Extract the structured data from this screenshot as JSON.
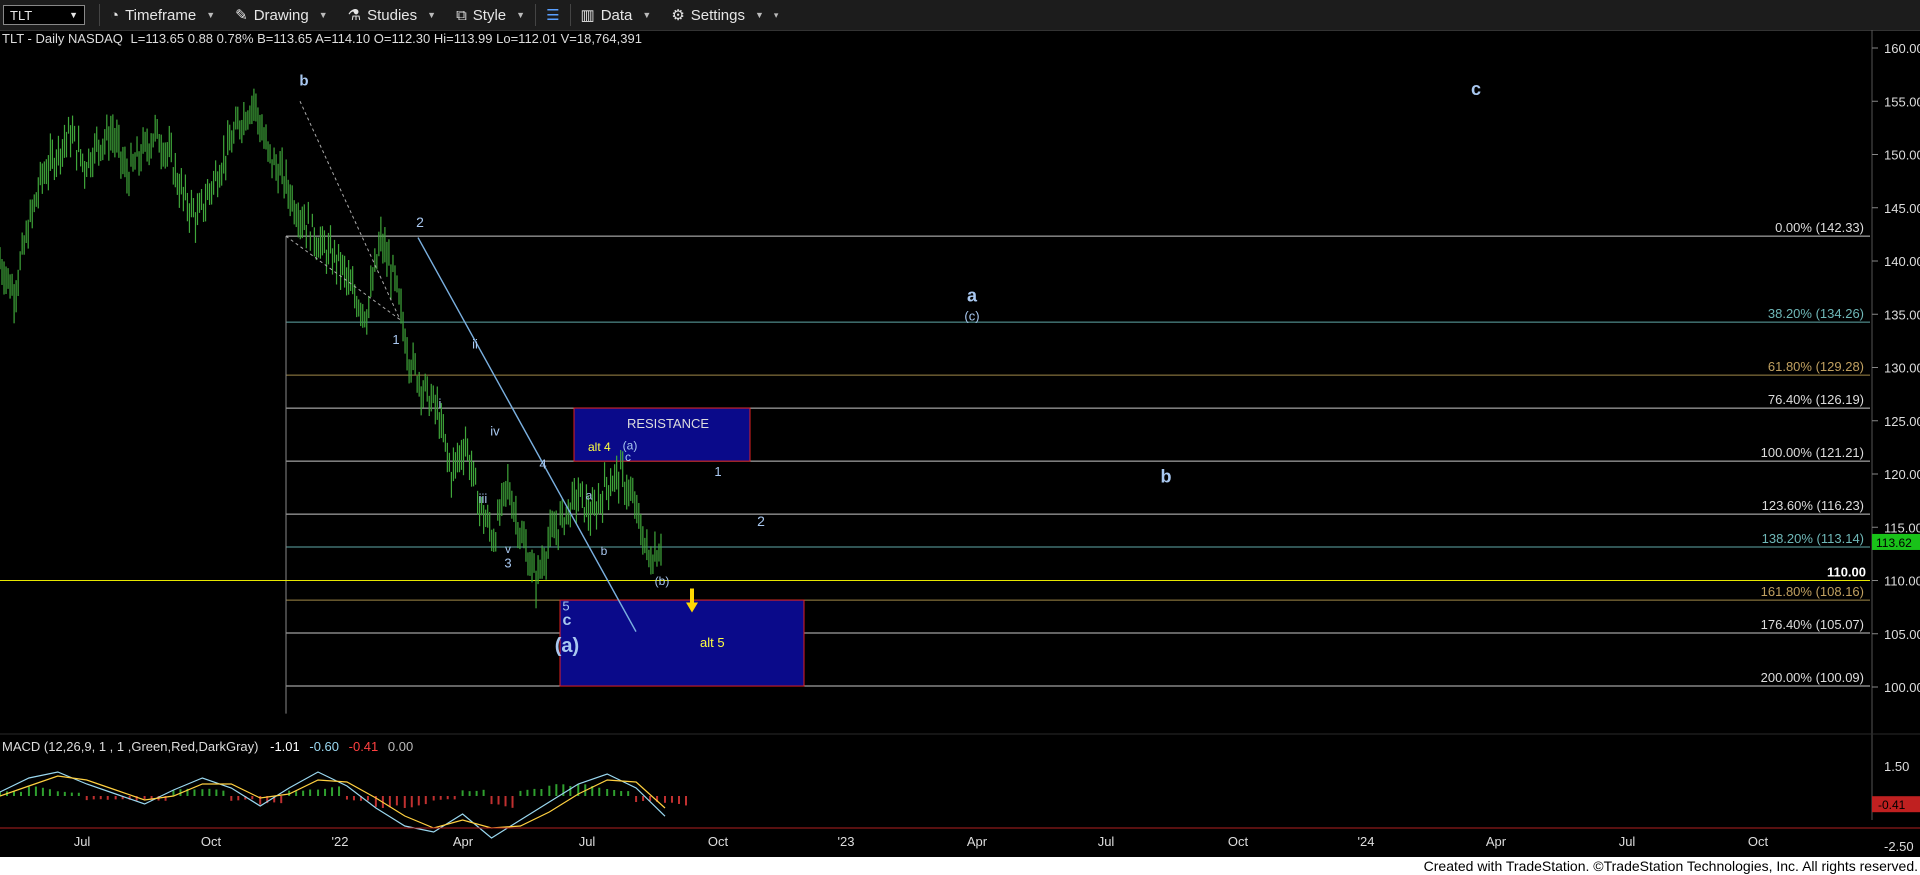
{
  "toolbar": {
    "symbol": "TLT",
    "timeframe": "Timeframe",
    "drawing": "Drawing",
    "studies": "Studies",
    "style": "Style",
    "data": "Data",
    "settings": "Settings"
  },
  "header": {
    "symbol_line": "TLT - Daily  NASDAQ",
    "quote": "L=113.65  0.88  0.78%  B=113.65  A=114.10  O=112.30  Hi=113.99  Lo=112.01  V=18,764,391"
  },
  "macd": {
    "label": "MACD (12,26,9, 1 , 1 ,Green,Red,DarkGray)",
    "v1": "-1.01",
    "v2": "-0.60",
    "v3": "-0.41",
    "v4": "0.00",
    "ticks": [
      "1.50",
      "-2.50"
    ],
    "current": "-0.41",
    "v1_color": "#ffffff",
    "v2_color": "#9ad8f0",
    "v3_color": "#ff4040",
    "v4_color": "#bbbbbb"
  },
  "footer": "Created with TradeStation. ©TradeStation Technologies, Inc. All rights reserved.",
  "colors": {
    "price_bar": "#3fa63a",
    "fib_line": "#c8c8c8",
    "yellow_line": "#e8e800",
    "box_fill": "#0a0a8a",
    "box_border": "#e02020",
    "wave_label": "#a9c8f0",
    "last_price_bg": "#19c219"
  },
  "chart_data": {
    "type": "line",
    "title": "TLT - Daily",
    "ylim": [
      97.5,
      162
    ],
    "y_ticks": [
      100,
      105,
      110,
      115,
      120,
      125,
      130,
      135,
      140,
      145,
      150,
      155,
      160
    ],
    "x_tick_labels": [
      "Jul",
      "Oct",
      "'22",
      "Apr",
      "Jul",
      "Oct",
      "'23",
      "Apr",
      "Jul",
      "Oct",
      "'24",
      "Apr",
      "Jul",
      "Oct"
    ],
    "last_price": "113.62",
    "price_series": {
      "x_months": [
        0,
        0.5,
        1,
        1.5,
        2,
        2.5,
        3,
        3.5,
        4,
        4.5,
        5,
        5.5,
        6,
        6.5,
        7,
        7.5,
        8,
        8.5,
        9,
        9.5,
        10,
        10.5,
        11,
        11.5,
        12,
        12.5,
        13,
        13.5,
        14,
        14.5,
        15,
        15.5,
        16,
        16.5,
        17,
        17.5,
        18,
        18.5,
        19,
        19.5,
        20,
        20.5,
        21,
        21.5,
        22,
        22.5,
        23,
        23.5,
        24,
        24.5,
        25,
        25.5,
        26,
        26.5,
        27,
        27.5
      ],
      "close": [
        140,
        137,
        143,
        148,
        150,
        152,
        149,
        151,
        152,
        148,
        150,
        152,
        150,
        146,
        144,
        147,
        150,
        153,
        155,
        150,
        148,
        145,
        143,
        141,
        140,
        137,
        135,
        142,
        138,
        131,
        128,
        126,
        120,
        123,
        117,
        114,
        119,
        114,
        110,
        114,
        116,
        118,
        116,
        119,
        120,
        117,
        112,
        113.6
      ]
    },
    "fib_levels": [
      {
        "label": "0.00% (142.33)",
        "value": 142.33
      },
      {
        "label": "38.20% (134.26)",
        "value": 134.26
      },
      {
        "label": "61.80% (129.28)",
        "value": 129.28
      },
      {
        "label": "76.40% (126.19)",
        "value": 126.19
      },
      {
        "label": "100.00% (121.21)",
        "value": 121.21
      },
      {
        "label": "123.60% (116.23)",
        "value": 116.23
      },
      {
        "label": "138.20% (113.14)",
        "value": 113.14
      },
      {
        "label": "161.80% (108.16)",
        "value": 108.16
      },
      {
        "label": "176.40% (105.07)",
        "value": 105.07
      },
      {
        "label": "200.00% (100.09)",
        "value": 100.09
      }
    ],
    "horizontal_line": {
      "label": "110.00",
      "value": 110.0
    },
    "boxes": [
      {
        "label": "RESISTANCE",
        "sublabel": "alt 4",
        "y_low": 121.21,
        "y_high": 126.19
      },
      {
        "label": "alt 5",
        "y_low": 100.09,
        "y_high": 108.16
      }
    ],
    "wave_labels": [
      "b",
      "2",
      "1",
      "ii",
      "i",
      "iv",
      "iii",
      "v",
      "3",
      "4",
      "a",
      "b",
      "c",
      "(a)",
      "(b)",
      "5",
      "c",
      "(a)",
      "1",
      "2",
      "a",
      "(c)",
      "b",
      "c",
      "alt 4",
      "alt 5"
    ],
    "macd_series": {
      "macd": [
        0.2,
        0.9,
        1.2,
        0.6,
        0.1,
        -0.4,
        0.3,
        0.9,
        0.4,
        -0.5,
        0.4,
        1.2,
        0.5,
        -0.6,
        -1.5,
        -1.8,
        -0.9,
        -2.1,
        -1.2,
        -0.3,
        0.6,
        1.1,
        0.4,
        -1.01
      ],
      "signal": [
        0.0,
        0.5,
        1.0,
        0.8,
        0.3,
        -0.2,
        0.0,
        0.6,
        0.6,
        -0.1,
        0.1,
        0.8,
        0.7,
        -0.1,
        -1.0,
        -1.6,
        -1.2,
        -1.6,
        -1.5,
        -0.8,
        0.1,
        0.8,
        0.7,
        -0.6
      ]
    }
  }
}
